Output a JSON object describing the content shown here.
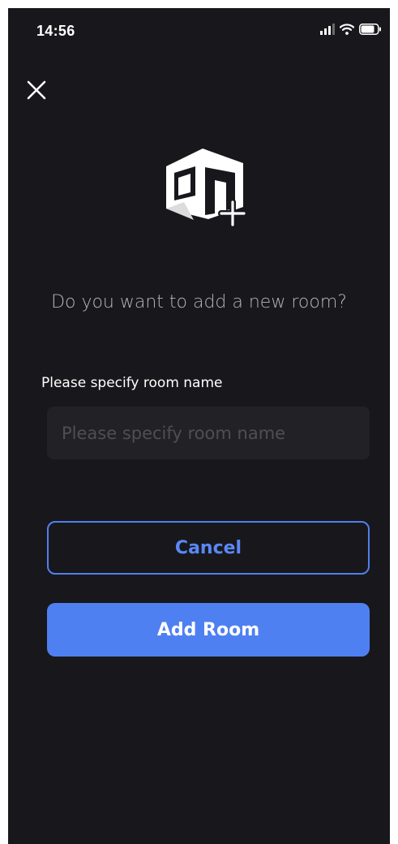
{
  "status_bar": {
    "time": "14:56",
    "icons": [
      "signal-icon",
      "wifi-icon",
      "battery-icon"
    ]
  },
  "header": {
    "close_icon": "close-icon"
  },
  "logo": {
    "icon": "add-room-icon"
  },
  "dialog": {
    "prompt": "Do you want to add a new room?",
    "field_label": "Please specify room name",
    "input_value": "",
    "input_placeholder": "Please specify room name",
    "cancel_label": "Cancel",
    "add_label": "Add Room"
  },
  "colors": {
    "background": "#18181c",
    "accent": "#4f80f2",
    "input_background": "#222226",
    "prompt_text": "#b5b5ba"
  }
}
